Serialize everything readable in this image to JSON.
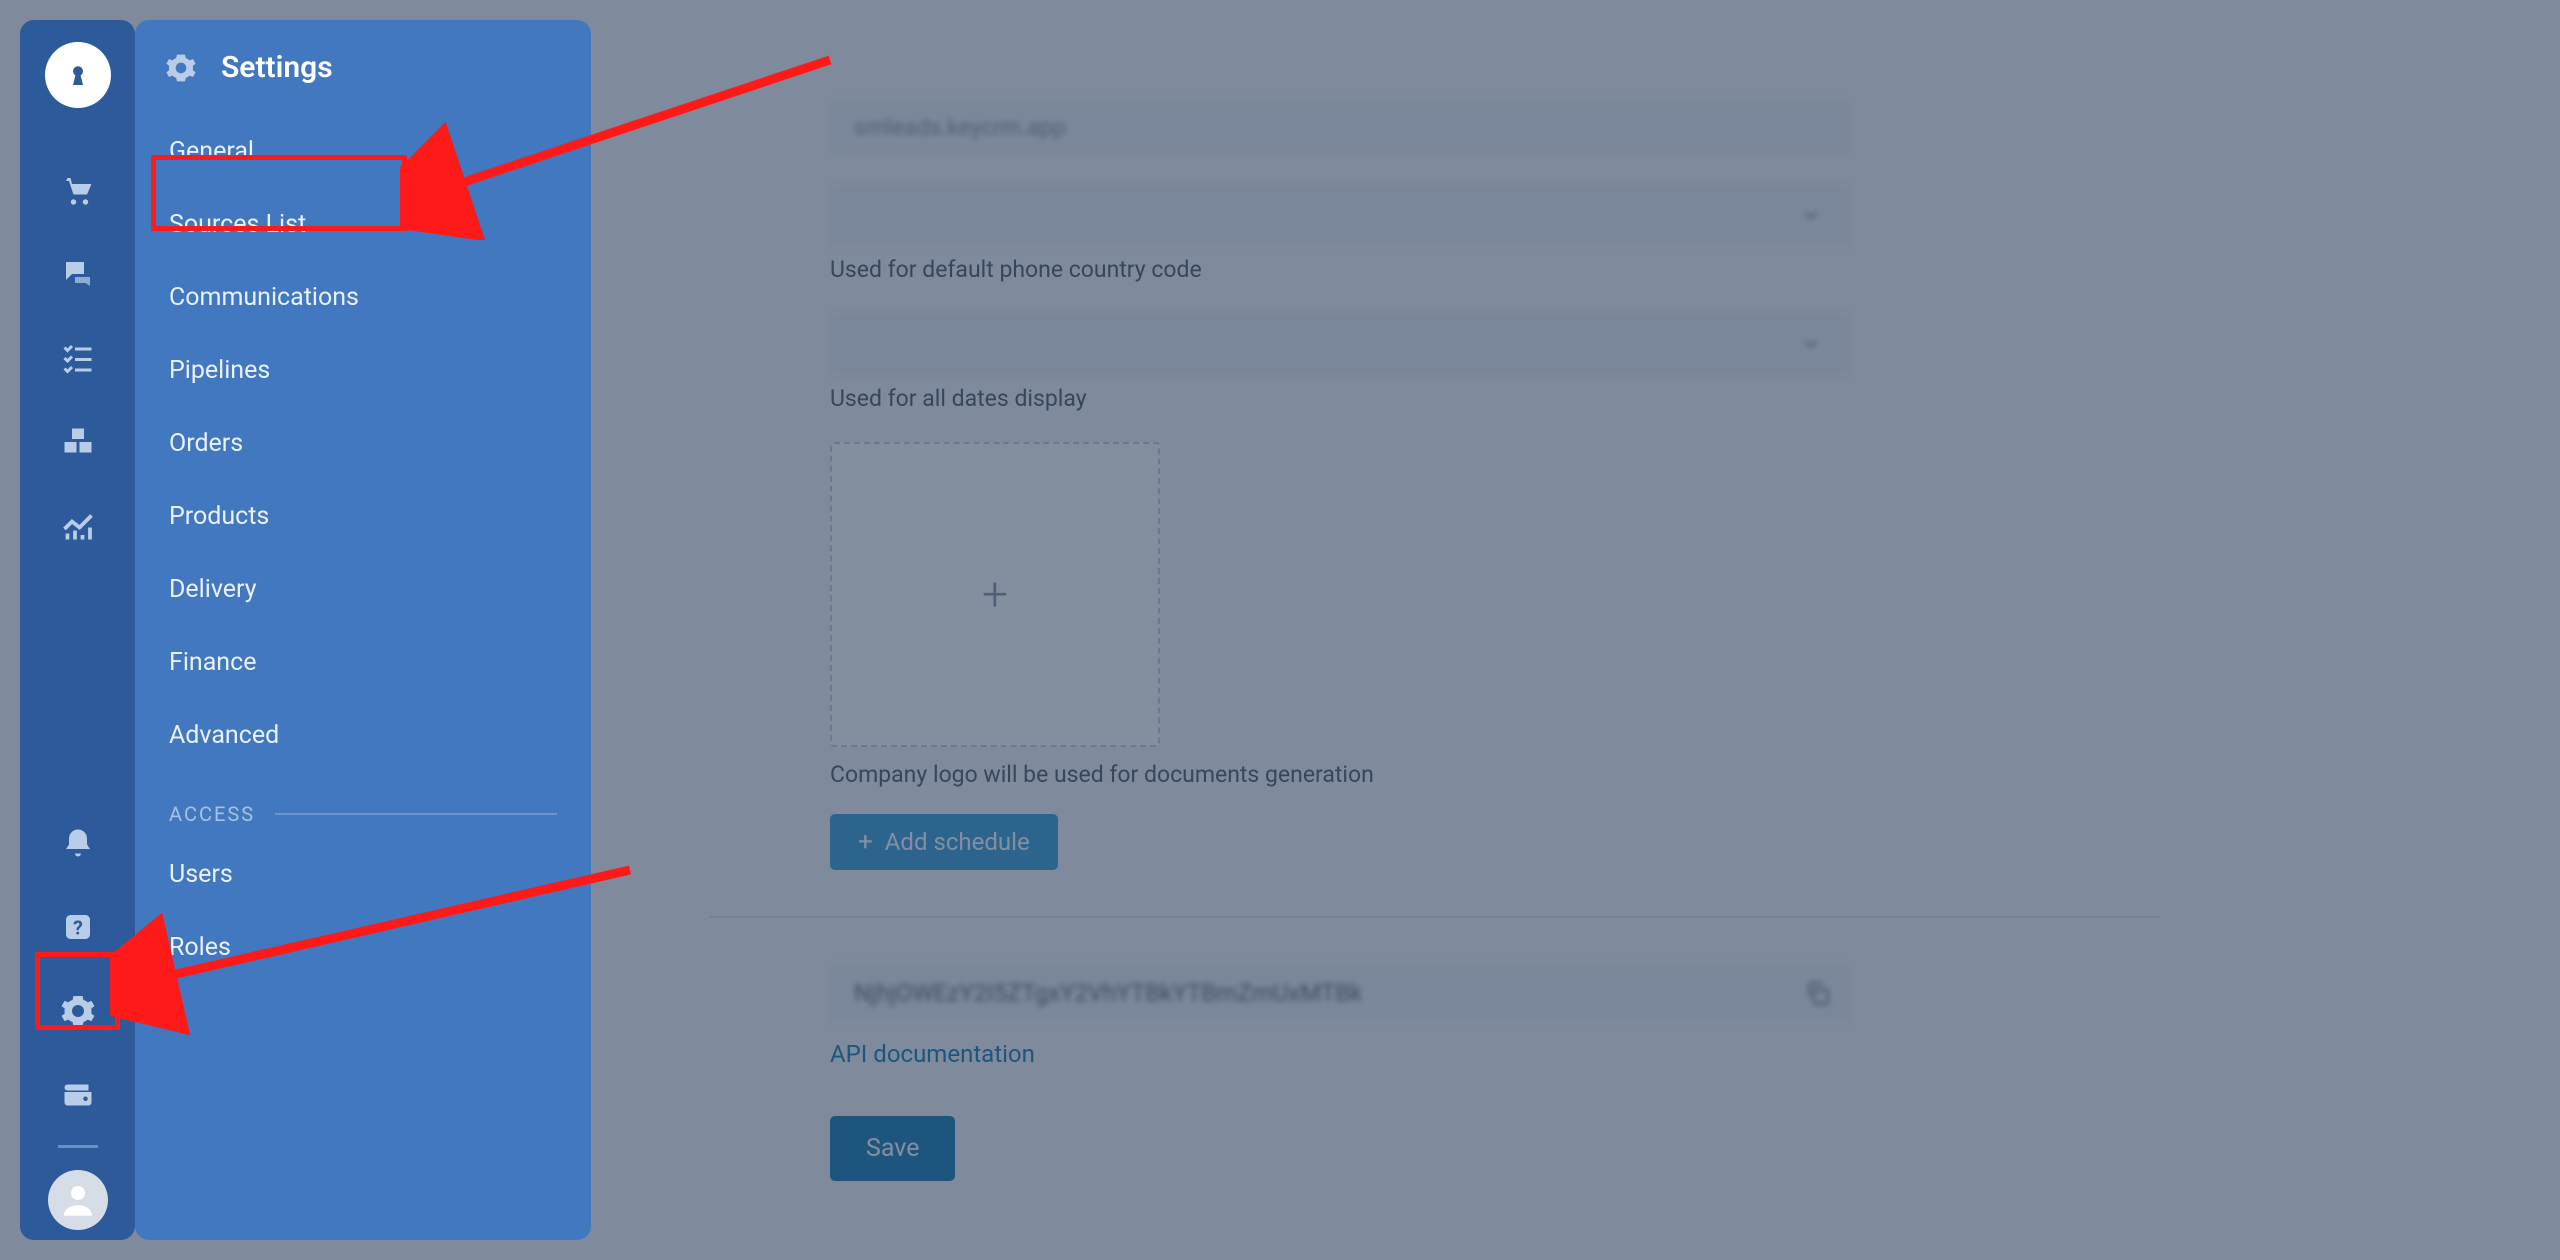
{
  "panel": {
    "title": "Settings",
    "items": [
      "General",
      "Sources List",
      "Communications",
      "Pipelines",
      "Orders",
      "Products",
      "Delivery",
      "Finance",
      "Advanced"
    ],
    "access_label": "ACCESS",
    "access_items": [
      "Users",
      "Roles"
    ]
  },
  "form": {
    "domain_value": "smleads.keycrm.app",
    "country_helper": "Used for default phone country code",
    "date_helper": "Used for all dates display",
    "logo_helper": "Company logo will be used for documents generation",
    "add_schedule": "Add schedule",
    "api_key": "NjhjOWEzY2I5ZTgxY2VhYTBkYTBmZmUxMTBk",
    "api_doc_link": "API documentation",
    "save": "Save"
  }
}
